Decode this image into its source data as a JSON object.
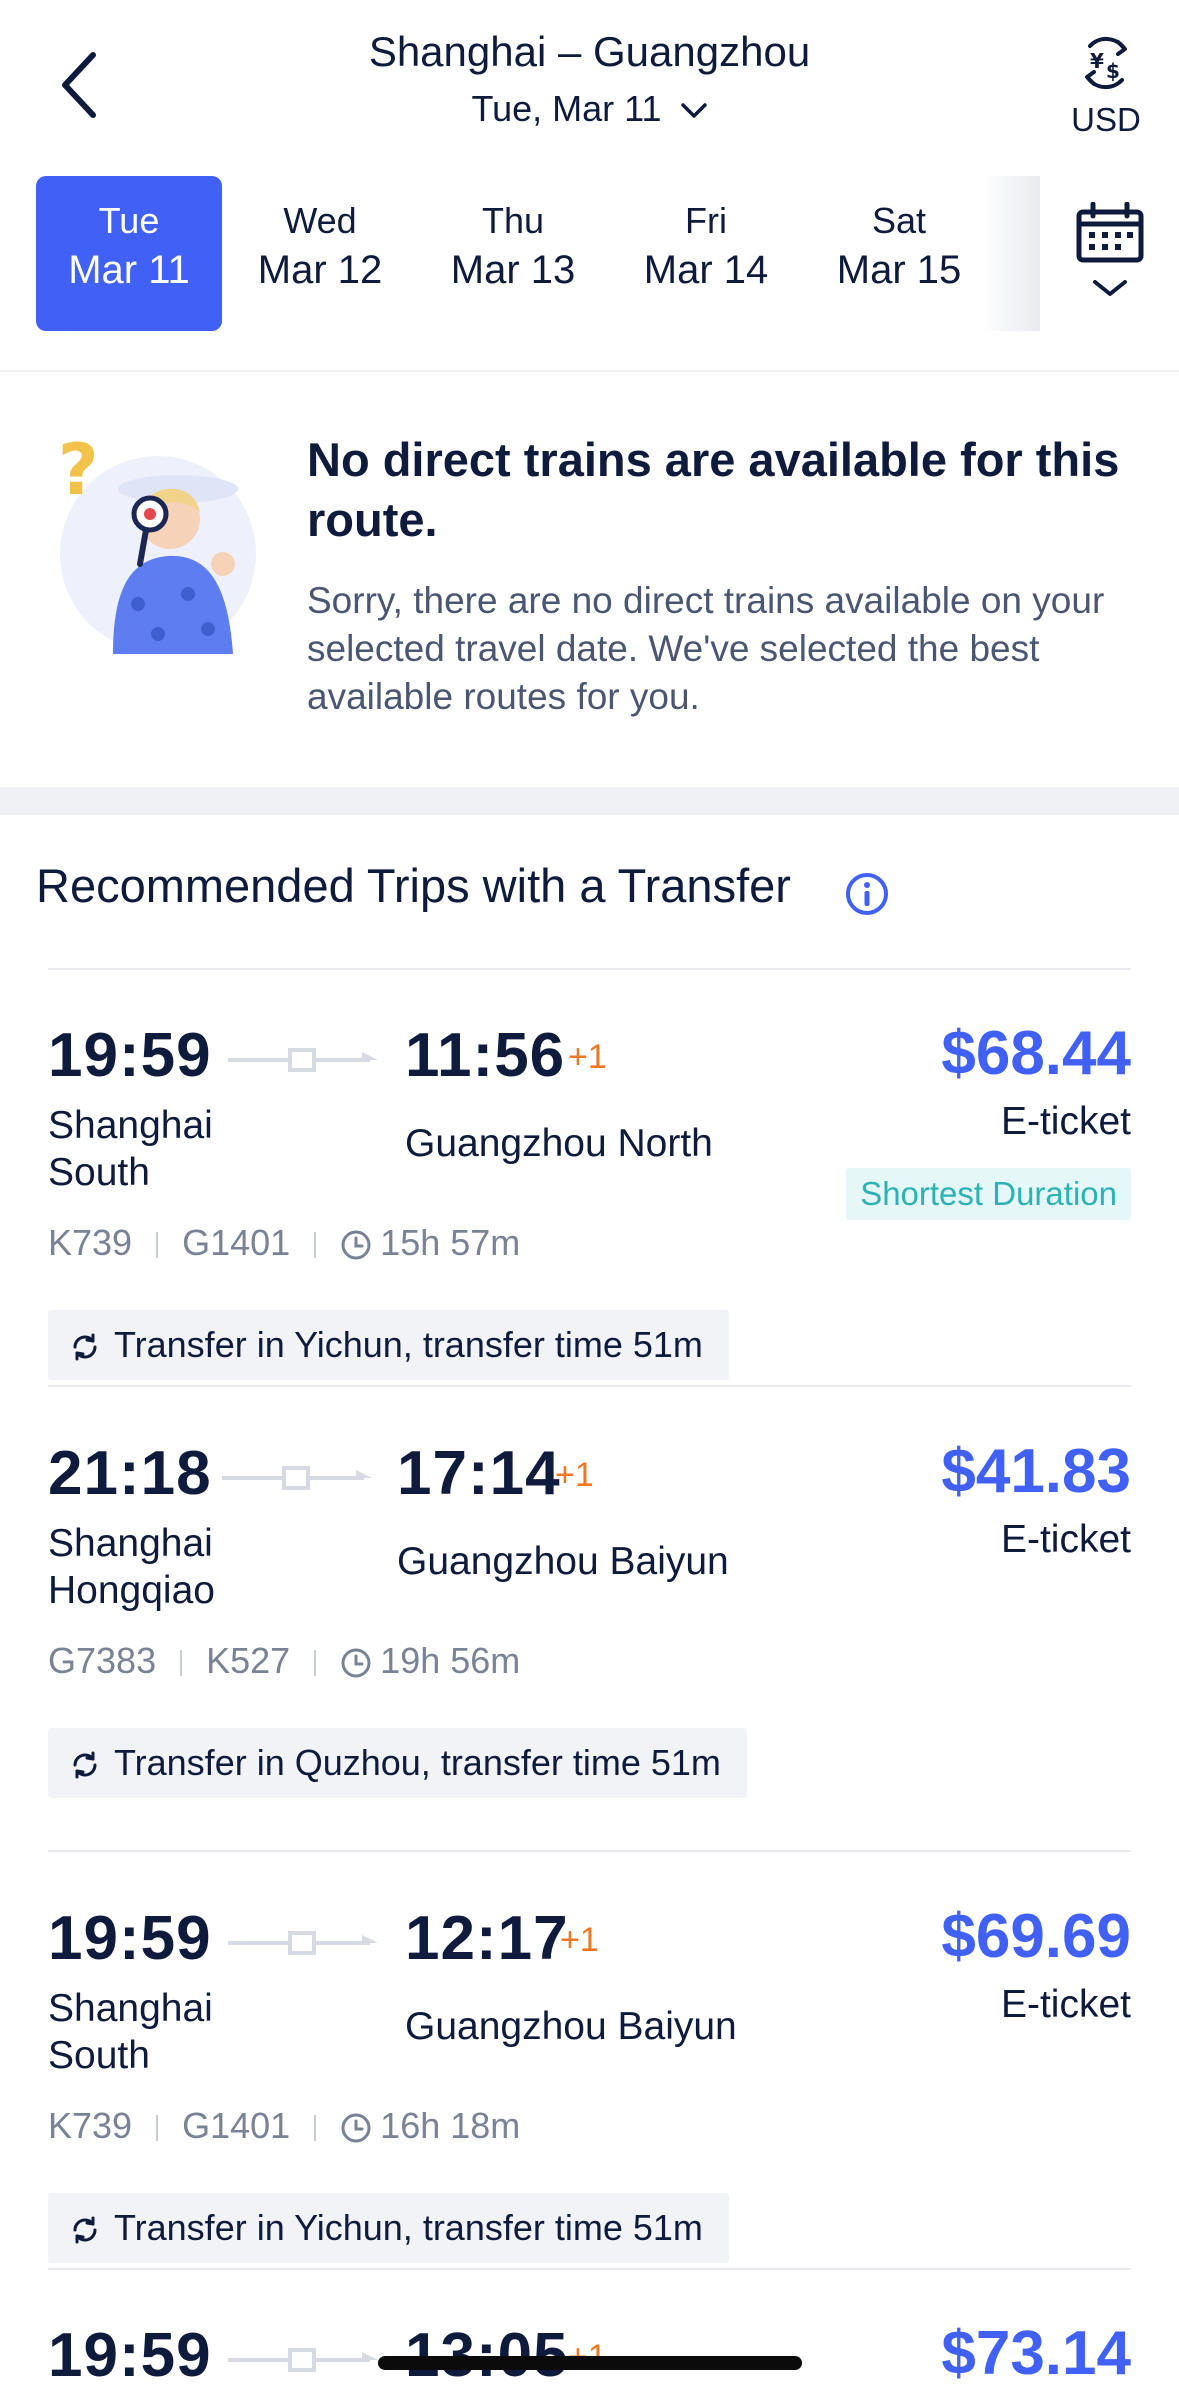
{
  "header": {
    "route": "Shanghai – Guangzhou",
    "date": "Tue, Mar 11",
    "currency": "USD"
  },
  "dates": [
    {
      "dow": "Tue",
      "dm": "Mar 11",
      "active": true
    },
    {
      "dow": "Wed",
      "dm": "Mar 12"
    },
    {
      "dow": "Thu",
      "dm": "Mar 13"
    },
    {
      "dow": "Fri",
      "dm": "Mar 14"
    },
    {
      "dow": "Sat",
      "dm": "Mar 15"
    }
  ],
  "notice": {
    "title": "No direct trains are available for this route.",
    "body": "Sorry, there are no direct trains available on your selected travel date. We've selected the best available routes for you."
  },
  "section": {
    "title": "Recommended Trips with a Transfer"
  },
  "trips": [
    {
      "dep_time": "19:59",
      "arr_time": "11:56",
      "day_offset": "+1",
      "dep_station": "Shanghai South",
      "arr_station": "Guangzhou North",
      "price": "$68.44",
      "ticket": "E-ticket",
      "badge": "Shortest Duration",
      "train1": "K739",
      "train2": "G1401",
      "duration": "15h 57m",
      "transfer": "Transfer in Yichun, transfer time 51m"
    },
    {
      "dep_time": "21:18",
      "arr_time": "17:14",
      "day_offset": "+1",
      "dep_station": "Shanghai Hongqiao",
      "arr_station": "Guangzhou Baiyun",
      "price": "$41.83",
      "ticket": "E-ticket",
      "train1": "G7383",
      "train2": "K527",
      "duration": "19h 56m",
      "transfer": "Transfer in Quzhou, transfer time 51m"
    },
    {
      "dep_time": "19:59",
      "arr_time": "12:17",
      "day_offset": "+1",
      "dep_station": "Shanghai South",
      "arr_station": "Guangzhou Baiyun",
      "price": "$69.69",
      "ticket": "E-ticket",
      "train1": "K739",
      "train2": "G1401",
      "duration": "16h 18m",
      "transfer": "Transfer in Yichun, transfer time 51m"
    },
    {
      "dep_time": "19:59",
      "arr_time": "13:05",
      "day_offset": "+1",
      "price": "$73.14"
    }
  ],
  "colors": {
    "accent": "#4160f5",
    "day_offset": "#f0771f",
    "badge": "#2cb1b4"
  }
}
